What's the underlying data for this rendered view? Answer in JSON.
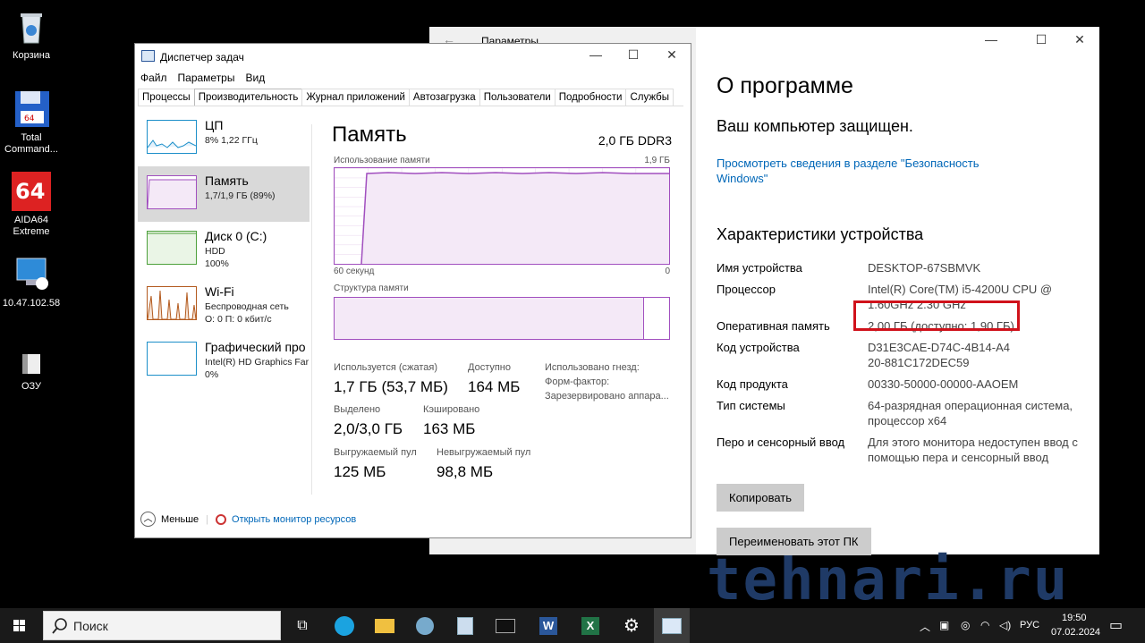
{
  "desktop": {
    "icons": [
      {
        "label": "Корзина"
      },
      {
        "label": "Total Command..."
      },
      {
        "label": "AIDA64 Extreme"
      },
      {
        "label": "10.47.102.58"
      },
      {
        "label": "ОЗУ"
      }
    ]
  },
  "settings": {
    "title": "Параметры",
    "heading": "О программе",
    "protected": "Ваш компьютер защищен.",
    "security_link": "Просмотреть сведения в разделе \"Безопасность Windows\"",
    "specs_heading": "Характеристики устройства",
    "specs": [
      {
        "k": "Имя устройства",
        "v": "DESKTOP-67SBMVK"
      },
      {
        "k": "Процессор",
        "v": "Intel(R) Core(TM) i5-4200U CPU @ 1.60GHz 2.30 GHz"
      },
      {
        "k": "Оперативная память",
        "v": "2,00 ГБ (доступно: 1,90 ГБ)"
      },
      {
        "k": "Код устройства",
        "v": "D31E3CAE-D74C-4B14-A420-881C172DEC59"
      },
      {
        "k": "Код продукта",
        "v": "00330-50000-00000-AAOEM"
      },
      {
        "k": "Тип системы",
        "v": "64-разрядная операционная система, процессор x64"
      },
      {
        "k": "Перо и сенсорный ввод",
        "v": "Для этого монитора недоступен ввод с помощью пера и сенсорный ввод"
      }
    ],
    "copy_button": "Копировать",
    "rename_button": "Переименовать этот ПК"
  },
  "taskmgr": {
    "title": "Диспетчер задач",
    "menu": [
      "Файл",
      "Параметры",
      "Вид"
    ],
    "tabs": [
      "Процессы",
      "Производительность",
      "Журнал приложений",
      "Автозагрузка",
      "Пользователи",
      "Подробности",
      "Службы"
    ],
    "sidebar": [
      {
        "name": "ЦП",
        "sub1": "8% 1,22 ГГц",
        "sub2": ""
      },
      {
        "name": "Память",
        "sub1": "1,7/1,9 ГБ (89%)",
        "sub2": ""
      },
      {
        "name": "Диск 0 (C:)",
        "sub1": "HDD",
        "sub2": "100%"
      },
      {
        "name": "Wi-Fi",
        "sub1": "Беспроводная сеть",
        "sub2": "О: 0 П: 0 кбит/с"
      },
      {
        "name": "Графический про",
        "sub1": "Intel(R) HD Graphics Far",
        "sub2": "0%"
      }
    ],
    "main": {
      "title": "Память",
      "spec": "2,0 ГБ DDR3",
      "usage_label": "Использование памяти",
      "usage_max": "1,9 ГБ",
      "axis_left": "60 секунд",
      "axis_right": "0",
      "struct_label": "Структура памяти",
      "stats": {
        "used_l": "Используется (сжатая)",
        "used_v": "1,7 ГБ (53,7 МБ)",
        "avail_l": "Доступно",
        "avail_v": "164 МБ",
        "slots_l": "Использовано гнезд:",
        "form_l": "Форм-фактор:",
        "reserved_l": "Зарезервировано аппара...",
        "committed_l": "Выделено",
        "committed_v": "2,0/3,0 ГБ",
        "cached_l": "Кэшировано",
        "cached_v": "163 МБ",
        "paged_l": "Выгружаемый пул",
        "paged_v": "125 МБ",
        "nonpaged_l": "Невыгружаемый пул",
        "nonpaged_v": "98,8 МБ"
      }
    },
    "footer_less": "Меньше",
    "footer_monitor": "Открыть монитор ресурсов"
  },
  "taskbar": {
    "search_placeholder": "Поиск",
    "lang": "РУС",
    "time": "19:50",
    "date": "07.02.2024"
  },
  "watermark": "tehnari.ru"
}
